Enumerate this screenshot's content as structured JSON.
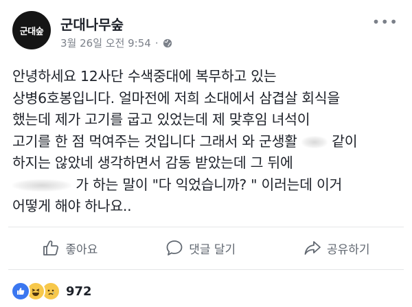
{
  "post": {
    "avatar_text": "군대숲",
    "page_name": "군대나무숲",
    "date": "3월 26일 오전 9:54",
    "separator": "·",
    "more_label": "•••"
  },
  "content": {
    "lines": [
      "안녕하세요 12사단 수색중대에 복무하고 있는",
      "상병6호봉입니다. 얼마전에 저희 소대에서 삼겹살 회식을",
      "했는데 제가 고기를 굽고 있었는데 제 맞후임 녀석이",
      "고기를 한 점 먹여주는 것입니다 그래서 와 군생활",
      "같이",
      "하지는 않았네 생각하면서 감동 받았는데 그 뒤에",
      "가 하는 말이 \"다 익었습니까? \" 이러는데 이거",
      "어떻게 해야 하나요.."
    ]
  },
  "actions": {
    "like_label": "좋아요",
    "comment_label": "댓글 달기",
    "share_label": "공유하기"
  },
  "reactions": {
    "icons": [
      "like-icon",
      "haha-icon",
      "sad-icon"
    ],
    "count": "972"
  },
  "colors": {
    "text": "#1d2129",
    "muted": "#7b8089",
    "like_blue": "#3b77f0",
    "emoji_yellow": "#f7c84b"
  }
}
